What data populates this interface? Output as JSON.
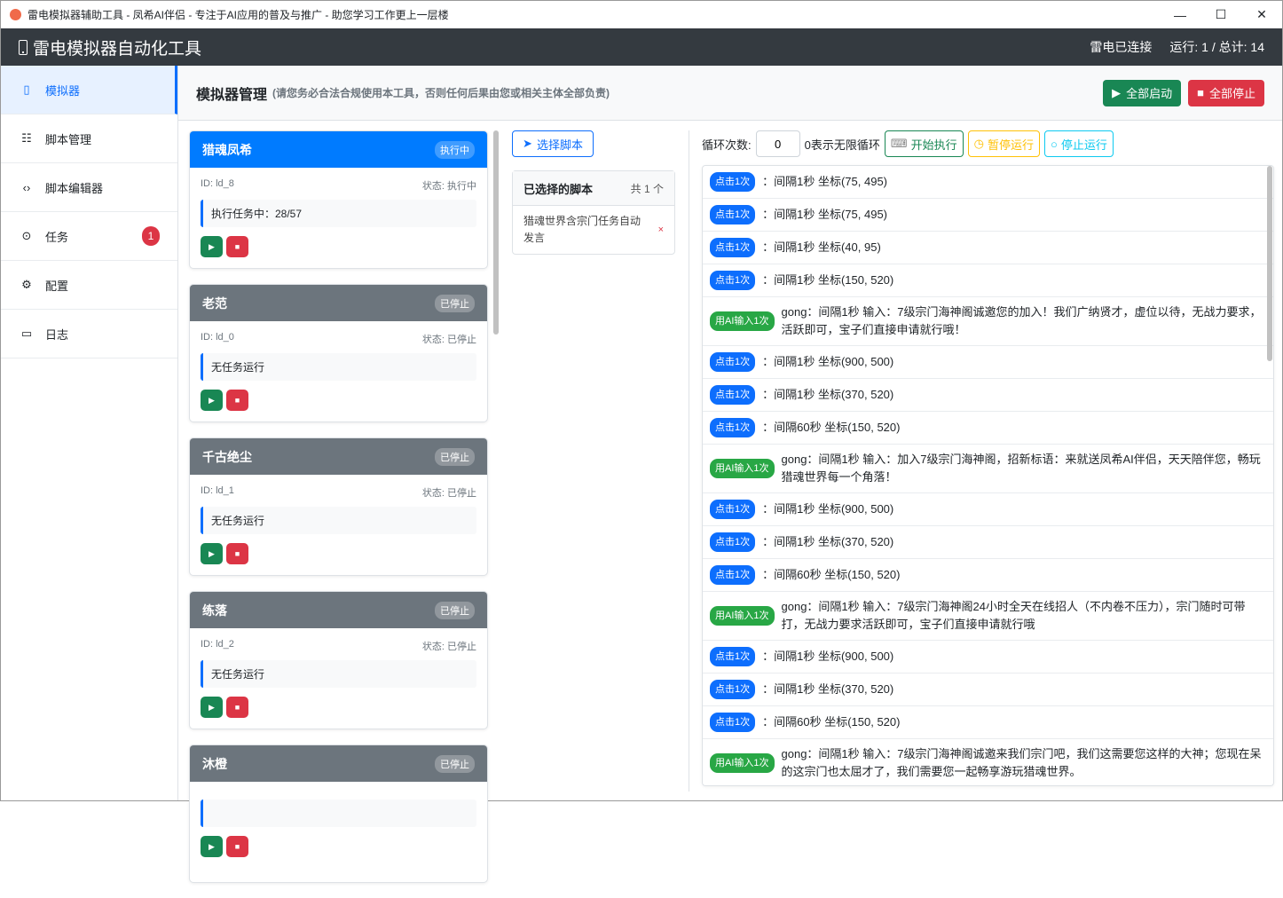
{
  "window": {
    "title": "雷电模拟器辅助工具 - 凤希AI伴侣 - 专注于AI应用的普及与推广 - 助您学习工作更上一层楼",
    "minimize": "—",
    "maximize": "☐",
    "close": "✕"
  },
  "header": {
    "title": "雷电模拟器自动化工具",
    "connection": "雷电已连接",
    "stats": "运行: 1 / 总计: 14"
  },
  "sidebar": {
    "items": [
      {
        "label": "模拟器",
        "icon": "▯"
      },
      {
        "label": "脚本管理",
        "icon": "☷"
      },
      {
        "label": "脚本编辑器",
        "icon": "‹›"
      },
      {
        "label": "任务",
        "icon": "⊙",
        "badge": "1"
      },
      {
        "label": "配置",
        "icon": "⚙"
      },
      {
        "label": "日志",
        "icon": "▭"
      }
    ]
  },
  "main": {
    "title": "模拟器管理",
    "notice": "(请您务必合法合规使用本工具，否则任何后果由您或相关主体全部负责)",
    "start_all": "全部启动",
    "stop_all": "全部停止"
  },
  "cards": [
    {
      "name": "猎魂凤希",
      "status_badge": "执行中",
      "id": "ID: ld_8",
      "status": "状态: 执行中",
      "task": "执行任务中：28/57",
      "running": true
    },
    {
      "name": "老范",
      "status_badge": "已停止",
      "id": "ID: ld_0",
      "status": "状态: 已停止",
      "task": "无任务运行"
    },
    {
      "name": "千古绝尘",
      "status_badge": "已停止",
      "id": "ID: ld_1",
      "status": "状态: 已停止",
      "task": "无任务运行"
    },
    {
      "name": "练落",
      "status_badge": "已停止",
      "id": "ID: ld_2",
      "status": "状态: 已停止",
      "task": "无任务运行"
    },
    {
      "name": "沐橙",
      "status_badge": "已停止",
      "id": "",
      "status": "",
      "task": ""
    }
  ],
  "scripts": {
    "select_label": "选择脚本",
    "selected_title": "已选择的脚本",
    "count": "共 1 个",
    "items": [
      "猎魂世界含宗门任务自动发言"
    ],
    "remove": "×"
  },
  "controls": {
    "loop_label": "循环次数:",
    "loop_value": "0",
    "loop_hint": "0表示无限循环",
    "start": "开始执行",
    "pause": "暂停运行",
    "stop": "停止运行"
  },
  "log": [
    {
      "tag": "点击1次",
      "type": "c",
      "text": "：间隔1秒 坐标(75, 495)"
    },
    {
      "tag": "点击1次",
      "type": "c",
      "text": "：间隔1秒 坐标(75, 495)"
    },
    {
      "tag": "点击1次",
      "type": "c",
      "text": "：间隔1秒 坐标(40, 95)"
    },
    {
      "tag": "点击1次",
      "type": "c",
      "text": "：间隔1秒 坐标(150, 520)"
    },
    {
      "tag": "用AI输入1次",
      "type": "a",
      "text": "gong：间隔1秒 输入：7级宗门海神阁诚邀您的加入！我们广纳贤才，虚位以待，无战力要求，活跃即可，宝子们直接申请就行哦！"
    },
    {
      "tag": "点击1次",
      "type": "c",
      "text": "：间隔1秒 坐标(900, 500)"
    },
    {
      "tag": "点击1次",
      "type": "c",
      "text": "：间隔1秒 坐标(370, 520)"
    },
    {
      "tag": "点击1次",
      "type": "c",
      "text": "：间隔60秒 坐标(150, 520)"
    },
    {
      "tag": "用AI输入1次",
      "type": "a",
      "text": "gong：间隔1秒 输入：加入7级宗门海神阁，招新标语：来就送凤希AI伴侣，天天陪伴您，畅玩猎魂世界每一个角落！"
    },
    {
      "tag": "点击1次",
      "type": "c",
      "text": "：间隔1秒 坐标(900, 500)"
    },
    {
      "tag": "点击1次",
      "type": "c",
      "text": "：间隔1秒 坐标(370, 520)"
    },
    {
      "tag": "点击1次",
      "type": "c",
      "text": "：间隔60秒 坐标(150, 520)"
    },
    {
      "tag": "用AI输入1次",
      "type": "a",
      "text": "gong：间隔1秒 输入：7级宗门海神阁24小时全天在线招人（不内卷不压力），宗门随时可带打，无战力要求活跃即可，宝子们直接申请就行哦"
    },
    {
      "tag": "点击1次",
      "type": "c",
      "text": "：间隔1秒 坐标(900, 500)"
    },
    {
      "tag": "点击1次",
      "type": "c",
      "text": "：间隔1秒 坐标(370, 520)"
    },
    {
      "tag": "点击1次",
      "type": "c",
      "text": "：间隔60秒 坐标(150, 520)"
    },
    {
      "tag": "用AI输入1次",
      "type": "a",
      "text": "gong：间隔1秒 输入：7级宗门海神阁诚邀来我们宗门吧，我们这需要您这样的大神；您现在呆的这宗门也太屈才了，我们需要您一起畅享游玩猎魂世界。"
    }
  ]
}
